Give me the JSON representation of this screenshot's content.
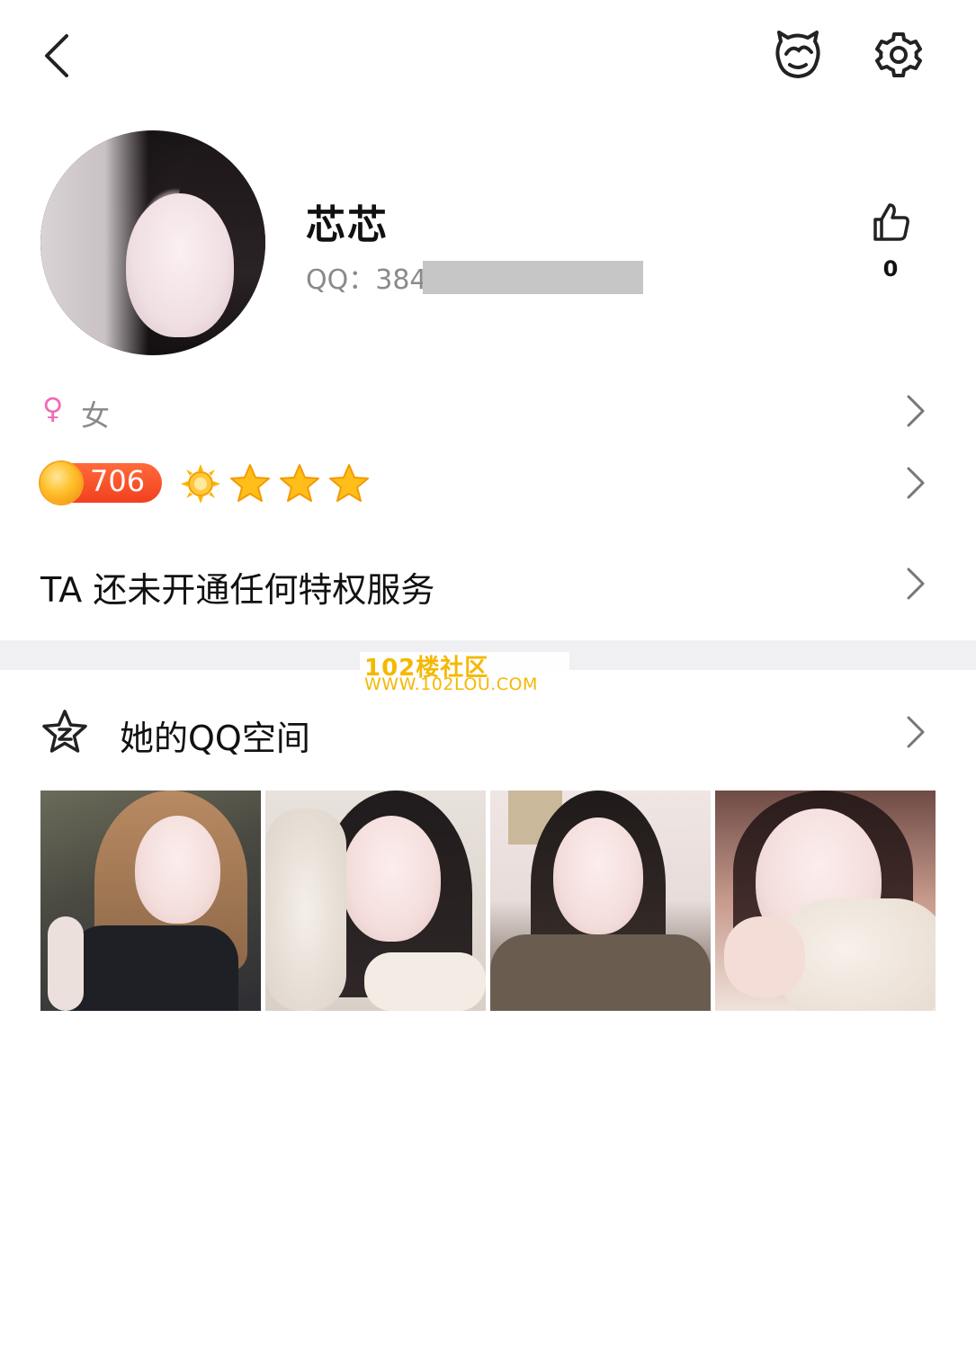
{
  "header": {
    "back_icon": "chevron-left-icon",
    "mascot_icon": "penguin-outline-icon",
    "settings_icon": "gear-icon"
  },
  "profile": {
    "name": "芯芯",
    "qq_label": "QQ：384",
    "like_icon": "thumbs-up-icon",
    "like_count": "0"
  },
  "gender": {
    "symbol": "♀",
    "label": "女",
    "symbol_color": "#f06bb6"
  },
  "level": {
    "value": "706",
    "icons": [
      "sun-icon",
      "star-icon",
      "star-icon",
      "star-icon"
    ]
  },
  "privilege": {
    "text": "TA 还未开通任何特权服务"
  },
  "watermark": {
    "line1": "102楼社区",
    "line2": "WWW.102LOU.COM"
  },
  "qzone": {
    "icon": "qzone-star-icon",
    "label": "她的QQ空间",
    "photos": [
      "photo-1",
      "photo-2",
      "photo-3",
      "photo-4"
    ]
  },
  "colors": {
    "accent_orange": "#f2401f",
    "star_gold": "#ffb400",
    "gray_text": "#8a8a8a"
  }
}
